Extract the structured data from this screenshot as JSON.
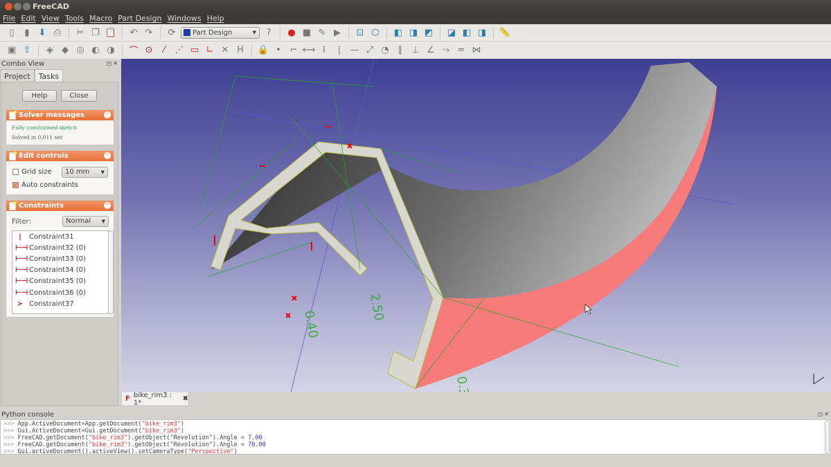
{
  "window": {
    "title": "FreeCAD"
  },
  "menu": [
    "File",
    "Edit",
    "View",
    "Tools",
    "Macro",
    "Part Design",
    "Windows",
    "Help"
  ],
  "toolbar": {
    "workbench": "Part Design"
  },
  "combo_view": {
    "title": "Combo View",
    "tabs": [
      "Project",
      "Tasks"
    ],
    "help_label": "Help",
    "close_label": "Close"
  },
  "solver": {
    "title": "Solver messages",
    "status": "Fully constrained sketch",
    "time": "Solved in 0.011 sec"
  },
  "edit_controls": {
    "title": "Edit controls",
    "grid_label": "Grid size",
    "grid_value": "10 mm",
    "auto_label": "Auto constraints"
  },
  "constraints": {
    "title": "Constraints",
    "filter_label": "Filter:",
    "filter_value": "Normal",
    "items": [
      {
        "label": "Constraint31",
        "icon": "vertical-constraint-icon"
      },
      {
        "label": "Constraint32 (0)",
        "icon": "distance-constraint-icon"
      },
      {
        "label": "Constraint33 (0)",
        "icon": "distance-constraint-icon"
      },
      {
        "label": "Constraint34 (0)",
        "icon": "distance-constraint-icon"
      },
      {
        "label": "Constraint35 (0)",
        "icon": "distance-constraint-icon"
      },
      {
        "label": "Constraint36 (0)",
        "icon": "distance-constraint-icon"
      },
      {
        "label": "Constraint37",
        "icon": "symmetric-constraint-icon"
      }
    ]
  },
  "document_tab": {
    "label": "bike_rim3 : 1*"
  },
  "console": {
    "title": "Python console",
    "lines": [
      [
        ">>> ",
        "App.ActiveDocument=App.getDocument(",
        "\"bike_rim3\"",
        ")",
        "",
        ""
      ],
      [
        ">>> ",
        "Gui.ActiveDocument=Gui.getDocument(",
        "\"bike_rim3\"",
        ")",
        "",
        ""
      ],
      [
        ">>> ",
        "FreeCAD.getDocument(",
        "\"bike_rim3\"",
        ").getObject(\"Revolution\").Angle = ",
        "7.00",
        ""
      ],
      [
        ">>> ",
        "FreeCAD.getDocument(",
        "\"bike_rim3\"",
        ").getObject(\"Revolution\").Angle = ",
        "70.00",
        ""
      ],
      [
        ">>> ",
        "Gui.activeDocument().activeView().setCameraType(",
        "\"Perspective\"",
        ")",
        "",
        ""
      ]
    ]
  },
  "colors": {
    "accent": "#e8703b",
    "pink_face": "#f77b7b",
    "constraint": "#22aa22"
  }
}
